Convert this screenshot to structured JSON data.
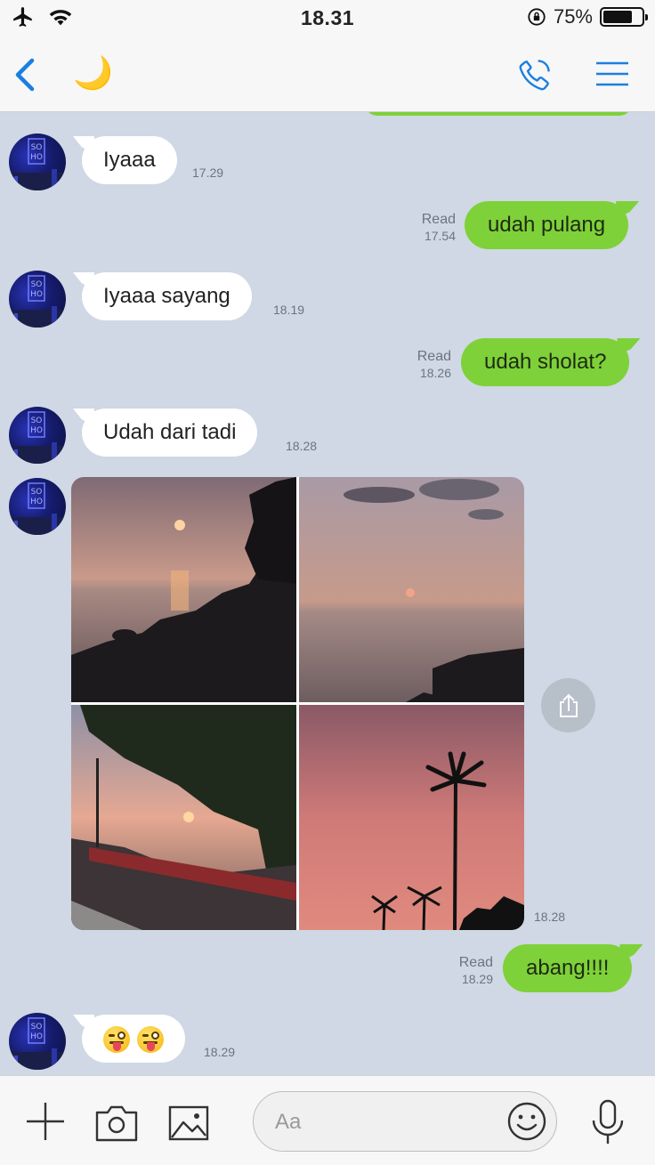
{
  "status_bar": {
    "time": "18.31",
    "battery_percent": "75%",
    "battery_level": 0.75
  },
  "header": {
    "contact_emoji": "🌙"
  },
  "messages": [
    {
      "side": "in",
      "text": "Iyaaa",
      "time": "17.29"
    },
    {
      "side": "out",
      "text": "udah pulang",
      "status": "Read",
      "time": "17.54"
    },
    {
      "side": "in",
      "text": "Iyaaa sayang",
      "time": "18.19"
    },
    {
      "side": "out",
      "text": "udah sholat?",
      "status": "Read",
      "time": "18.26"
    },
    {
      "side": "in",
      "text": "Udah dari tadi",
      "time": "18.28"
    },
    {
      "side": "in",
      "type": "photos",
      "count": 4,
      "time": "18.28"
    },
    {
      "side": "out",
      "text": "abang!!!!",
      "status": "Read",
      "time": "18.29"
    },
    {
      "side": "in",
      "type": "emoji",
      "emojis": [
        "winking-tongue-face",
        "winking-tongue-face"
      ],
      "time": "18.29"
    }
  ],
  "input": {
    "placeholder": "Aa"
  },
  "colors": {
    "outgoing_bubble": "#7ed138",
    "incoming_bubble": "#ffffff",
    "chat_background": "#cfd8e4",
    "accent": "#1a7fe0"
  }
}
